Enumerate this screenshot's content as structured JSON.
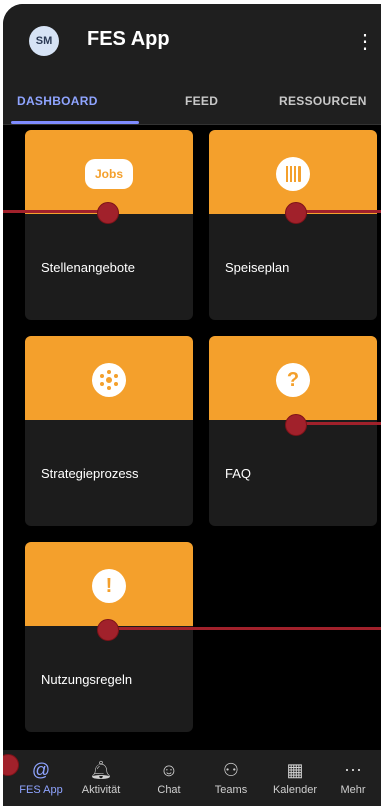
{
  "app": {
    "avatar_initials": "SM",
    "title": "FES App"
  },
  "tabs": [
    {
      "label": "DASHBOARD",
      "active": true
    },
    {
      "label": "FEED",
      "active": false
    },
    {
      "label": "RESSOURCEN",
      "active": false
    }
  ],
  "tiles": [
    {
      "label": "Stellenangebote",
      "icon": "jobs-icon",
      "icon_text": "Jobs"
    },
    {
      "label": "Speiseplan",
      "icon": "cutlery-icon"
    },
    {
      "label": "Strategieprozess",
      "icon": "network-icon"
    },
    {
      "label": "FAQ",
      "icon": "question-icon",
      "icon_text": "?"
    },
    {
      "label": "Nutzungsregeln",
      "icon": "exclamation-icon",
      "icon_text": "!"
    }
  ],
  "bottom_nav": [
    {
      "label": "FES App",
      "icon": "fes-app-icon",
      "active": true
    },
    {
      "label": "Aktivität",
      "icon": "bell-icon"
    },
    {
      "label": "Chat",
      "icon": "chat-icon"
    },
    {
      "label": "Teams",
      "icon": "teams-icon"
    },
    {
      "label": "Kalender",
      "icon": "calendar-icon"
    },
    {
      "label": "Mehr",
      "icon": "more-icon"
    }
  ],
  "colors": {
    "tile_accent": "#f4a02c",
    "tab_active": "#8fa4ff",
    "marker": "#a1212b"
  }
}
